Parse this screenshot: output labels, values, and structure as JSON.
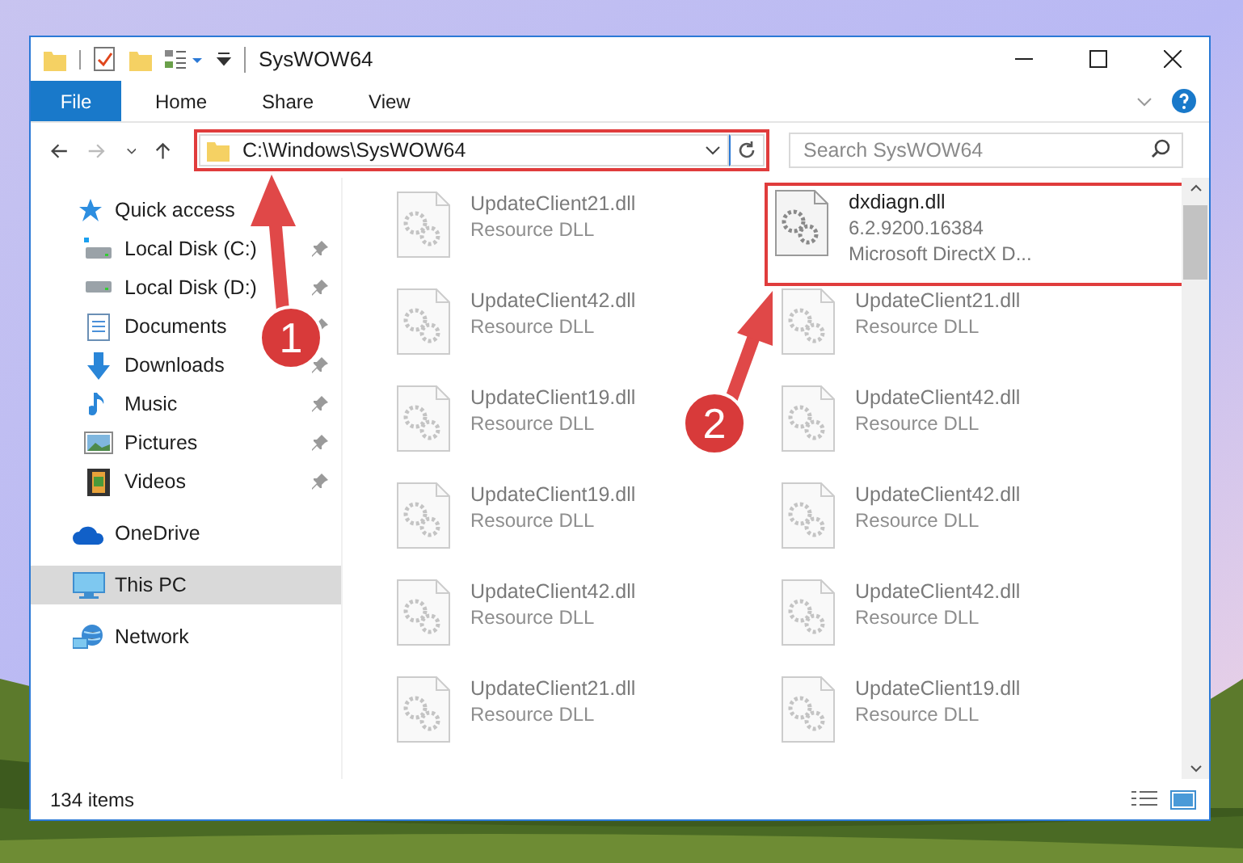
{
  "window": {
    "title": "SysWOW64"
  },
  "ribbon_tabs": [
    {
      "label": "File",
      "kind": "file"
    },
    {
      "label": "Home",
      "kind": "tab"
    },
    {
      "label": "Share",
      "kind": "tab"
    },
    {
      "label": "View",
      "kind": "tab"
    }
  ],
  "address_bar": {
    "path": "C:\\Windows\\SysWOW64",
    "highlighted": true
  },
  "search": {
    "placeholder": "Search SysWOW64"
  },
  "sidebar": {
    "items": [
      {
        "label": "Quick access",
        "kind": "star",
        "selected": false,
        "children": [
          {
            "label": "Local Disk (C:)",
            "kind": "system-drive",
            "pinned": true,
            "selected": false
          },
          {
            "label": "Local Disk (D:)",
            "kind": "drive",
            "pinned": true,
            "selected": false
          },
          {
            "label": "Documents",
            "kind": "documents",
            "pinned": true,
            "selected": false
          },
          {
            "label": "Downloads",
            "kind": "downloads",
            "pinned": true,
            "selected": false
          },
          {
            "label": "Music",
            "kind": "music",
            "pinned": true,
            "selected": false
          },
          {
            "label": "Pictures",
            "kind": "pictures",
            "pinned": true,
            "selected": false
          },
          {
            "label": "Videos",
            "kind": "videos",
            "pinned": true,
            "selected": false
          }
        ]
      },
      {
        "label": "OneDrive",
        "kind": "cloud",
        "selected": false
      },
      {
        "label": "This PC",
        "kind": "pc",
        "selected": true
      },
      {
        "label": "Network",
        "kind": "network",
        "selected": false
      }
    ]
  },
  "files": [
    {
      "name": "UpdateClient21.dll",
      "line_2": "Resource DLL",
      "faded": true,
      "highlighted": false
    },
    {
      "name": "dxdiagn.dll",
      "line_2": "6.2.9200.16384",
      "line_3": "Microsoft DirectX D...",
      "faded": false,
      "highlighted": true
    },
    {
      "name": "UpdateClient42.dll",
      "line_2": "Resource DLL",
      "faded": true,
      "highlighted": false
    },
    {
      "name": "UpdateClient21.dll",
      "line_2": "Resource DLL",
      "faded": true,
      "highlighted": false
    },
    {
      "name": "UpdateClient19.dll",
      "line_2": "Resource DLL",
      "faded": true,
      "highlighted": false
    },
    {
      "name": "UpdateClient42.dll",
      "line_2": "Resource DLL",
      "faded": true,
      "highlighted": false
    },
    {
      "name": "UpdateClient19.dll",
      "line_2": "Resource DLL",
      "faded": true,
      "highlighted": false
    },
    {
      "name": "UpdateClient42.dll",
      "line_2": "Resource DLL",
      "faded": true,
      "highlighted": false
    },
    {
      "name": "UpdateClient42.dll",
      "line_2": "Resource DLL",
      "faded": true,
      "highlighted": false
    },
    {
      "name": "UpdateClient42.dll",
      "line_2": "Resource DLL",
      "faded": true,
      "highlighted": false
    },
    {
      "name": "UpdateClient21.dll",
      "line_2": "Resource DLL",
      "faded": true,
      "highlighted": false
    },
    {
      "name": "UpdateClient19.dll",
      "line_2": "Resource DLL",
      "faded": true,
      "highlighted": false
    }
  ],
  "status_bar": {
    "item_count": "134 items"
  },
  "annotations": [
    {
      "label": "1",
      "kind": "address"
    },
    {
      "label": "2",
      "kind": "file"
    }
  ]
}
